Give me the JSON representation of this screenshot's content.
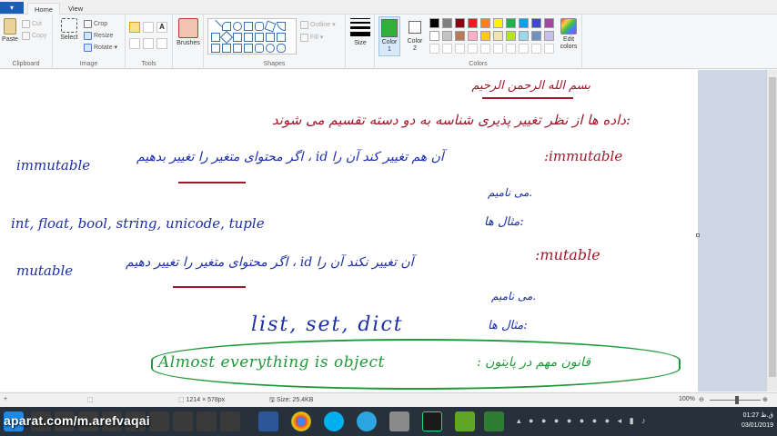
{
  "tabs": {
    "file": "▾",
    "home": "Home",
    "view": "View"
  },
  "clipboard": {
    "paste": "Paste",
    "cut": "Cut",
    "copy": "Copy",
    "label": "Clipboard"
  },
  "image": {
    "select": "Select",
    "crop": "Crop",
    "resize": "Resize",
    "rotate": "Rotate ▾",
    "label": "Image"
  },
  "tools": {
    "label": "Tools",
    "text_tool": "A"
  },
  "brushes": {
    "label": "Brushes"
  },
  "shapes": {
    "outline": "Outline ▾",
    "fill": "Fill ▾",
    "label": "Shapes"
  },
  "size": {
    "label": "Size"
  },
  "colors": {
    "color1_label": "Color\n1",
    "color2_label": "Color\n2",
    "edit_label": "Edit\ncolors",
    "label": "Colors",
    "color1": "#2fb13a",
    "color2": "#ffffff",
    "palette_row1": [
      "#000000",
      "#7f7f7f",
      "#880015",
      "#ed1c24",
      "#ff7f27",
      "#fff200",
      "#22b14c",
      "#00a2e8",
      "#3f48cc",
      "#a349a4"
    ],
    "palette_row2": [
      "#ffffff",
      "#c3c3c3",
      "#b97a57",
      "#ffaec9",
      "#ffc90e",
      "#efe4b0",
      "#b5e61d",
      "#99d9ea",
      "#7092be",
      "#c8bfe7"
    ]
  },
  "canvas": {
    "heading": "بسم الله الرحمن الرحیم",
    "line1": "داده ها از نظر تغییر پذیری شناسه به دو دسته تقسیم می شوند:",
    "line2_left": "immutable",
    "line2_mid": "اگر محتوای متغیر را تغییر بدهیم ، id آن هم تغییر کند آن را",
    "line2_right": ":immutable",
    "line3": "می نامیم.",
    "line4_left": "int, float, bool, string, unicode, tuple",
    "line4_right": "مثال ها:",
    "line5_left": "mutable",
    "line5_mid": "اگر محتوای متغیر را تغییر دهیم ، id آن تغییر نکند آن را",
    "line5_right": ":mutable",
    "line6": "می نامیم.",
    "line7_left": "list, set, dict",
    "line7_right": "مثال ها:",
    "note_left": "Almost everything is object",
    "note_right": ": قانون مهم در پایتون"
  },
  "status": {
    "dimensions": "1214 × 578px",
    "size": "Size: 25.4KB",
    "zoom": "100%"
  },
  "taskbar": {
    "watermark": "aparat.com/m.arefvaqai",
    "tray_time": "01:27 ق.ظ",
    "tray_date": "03/01/2019"
  }
}
